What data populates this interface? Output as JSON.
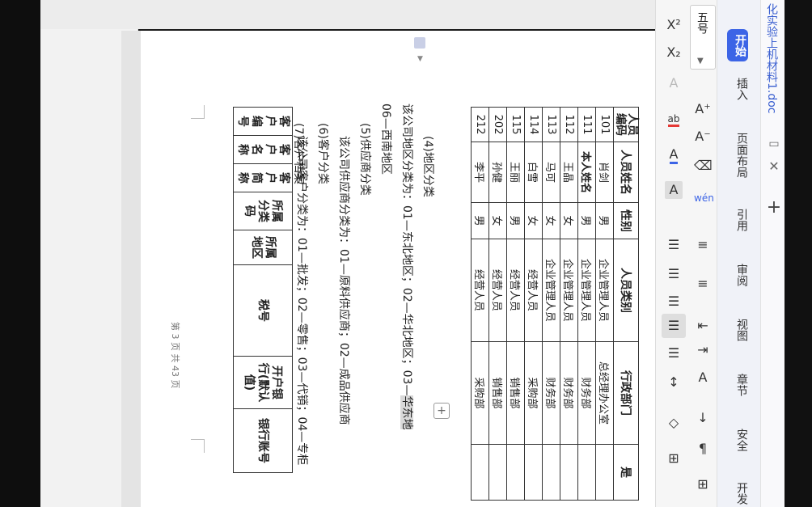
{
  "app": {
    "document_title": "化实验上机材料1.doc",
    "tabs": [
      "开始",
      "插入",
      "页面布局",
      "引用",
      "审阅",
      "视图",
      "章节",
      "安全",
      "开发"
    ],
    "active_tab": "开始",
    "font_size": "五号"
  },
  "toolbar_icons": {
    "superscript": "X²",
    "subscript": "X₂",
    "grow_font": "A⁺",
    "shrink_font": "A⁻",
    "clear_format": "eraser-icon",
    "pinyin": "wén",
    "bold_a": "A",
    "shading_a": "A",
    "highlight_ab": "ab"
  },
  "document": {
    "employee_table": {
      "headers": [
        "人员编码",
        "人员姓名",
        "性别",
        "人员类别",
        "行政部门",
        "是"
      ],
      "rows": [
        [
          "101",
          "肖剑",
          "男",
          "企业管理人员",
          "总经理办公室"
        ],
        [
          "111",
          "本人姓名",
          "男",
          "企业管理人员",
          "财务部"
        ],
        [
          "112",
          "王晶",
          "女",
          "企业管理人员",
          "财务部"
        ],
        [
          "113",
          "马可",
          "女",
          "企业管理人员",
          "财务部"
        ],
        [
          "114",
          "白雪",
          "女",
          "经营人员",
          "采购部"
        ],
        [
          "115",
          "王丽",
          "男",
          "经营人员",
          "销售部"
        ],
        [
          "202",
          "孙健",
          "女",
          "经营人员",
          "销售部"
        ],
        [
          "212",
          "李平",
          "男",
          "经营人员",
          "采购部"
        ]
      ]
    },
    "lines": {
      "h4": "(4)地区分类",
      "region_a": "该公司地区分类为：01—东北地区；02—华北地区；03—",
      "region_hl": "华东地",
      "region_b": "06—西南地区",
      "h5": "(5)供应商分类",
      "supplier": "该公司供应商分类为：01—原料供应商；02—成品供应商",
      "h6": "(6)客户分类",
      "customer": "该公司客户分类为：01—批发；02—零售；03—代销；04—专柜",
      "h7": "(7)客户档案"
    },
    "customer_headers": [
      "客户编号",
      "客户名称",
      "客户简称",
      "所属分类码",
      "所属地区",
      "税号",
      "开户银行(默认值)",
      "银行账号"
    ],
    "footer": "第 3 页 共 43 页"
  }
}
